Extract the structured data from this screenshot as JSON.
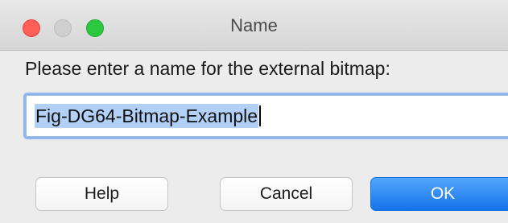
{
  "window": {
    "title": "Name"
  },
  "dialog": {
    "prompt": "Please enter a name for the external bitmap:",
    "name_field": {
      "value": "Fig-DG64-Bitmap-Example",
      "selected": true
    },
    "buttons": {
      "help_label": "Help",
      "cancel_label": "Cancel",
      "ok_label": "OK"
    }
  },
  "colors": {
    "close": "#fd5f57",
    "minimize": "#cfcfcf",
    "zoom": "#2ac940",
    "selection": "#b3d1f6",
    "focus_ring": "#8fb6ef",
    "default_button": "#1673ea"
  }
}
